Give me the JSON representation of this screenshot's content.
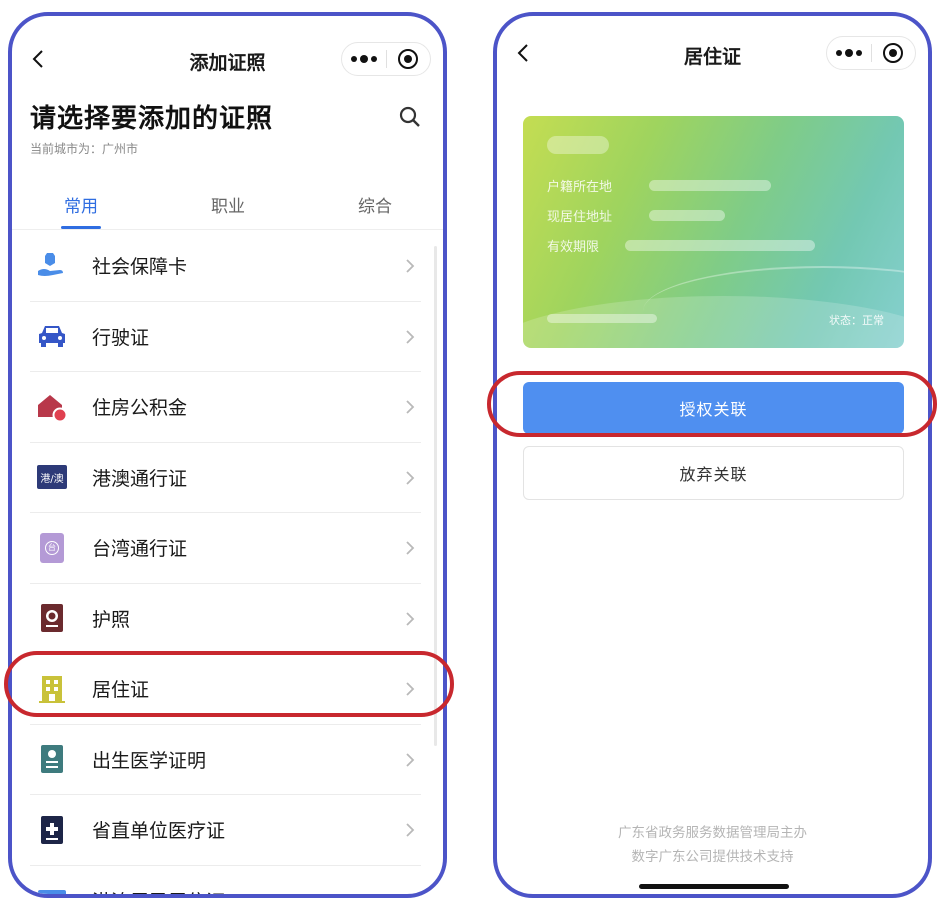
{
  "left_screen": {
    "nav_title": "添加证照",
    "heading": "请选择要添加的证照",
    "city_text": "当前城市为：广州市",
    "tabs": [
      {
        "label": "常用",
        "active": true
      },
      {
        "label": "职业",
        "active": false
      },
      {
        "label": "综合",
        "active": false
      }
    ],
    "items": [
      {
        "label": "社会保障卡",
        "icon": "social-security-icon",
        "color": "#4a8de8"
      },
      {
        "label": "行驶证",
        "icon": "car-icon",
        "color": "#3556c7"
      },
      {
        "label": "住房公积金",
        "icon": "house-fund-icon",
        "color": "#b8384a"
      },
      {
        "label": "港澳通行证",
        "icon": "hk-macau-permit-icon",
        "color": "#2d3a78",
        "icon_text": "港/澳"
      },
      {
        "label": "台湾通行证",
        "icon": "taiwan-permit-icon",
        "color": "#b49ad6",
        "icon_text": "台"
      },
      {
        "label": "护照",
        "icon": "passport-icon",
        "color": "#6b2a2e"
      },
      {
        "label": "居住证",
        "icon": "building-icon",
        "color": "#c9c23a",
        "highlighted": true
      },
      {
        "label": "出生医学证明",
        "icon": "birth-certificate-icon",
        "color": "#3e7b7e"
      },
      {
        "label": "省直单位医疗证",
        "icon": "medical-card-icon",
        "color": "#1d2547"
      },
      {
        "label": "港澳居民居住证",
        "icon": "hk-macau-residence-icon",
        "color": "#4a8de8"
      }
    ]
  },
  "right_screen": {
    "nav_title": "居住证",
    "card": {
      "fields": [
        "户籍所在地",
        "现居住地址",
        "有效期限"
      ],
      "status": "状态：正常"
    },
    "primary_button": "授权关联",
    "secondary_button": "放弃关联",
    "footer_line1": "广东省政务服务数据管理局主办",
    "footer_line2": "数字广东公司提供技术支持"
  },
  "colors": {
    "frame": "#4c54c8",
    "highlight": "#c8282e",
    "accent": "#2f6de1",
    "primary_button": "#4f8ff0"
  }
}
